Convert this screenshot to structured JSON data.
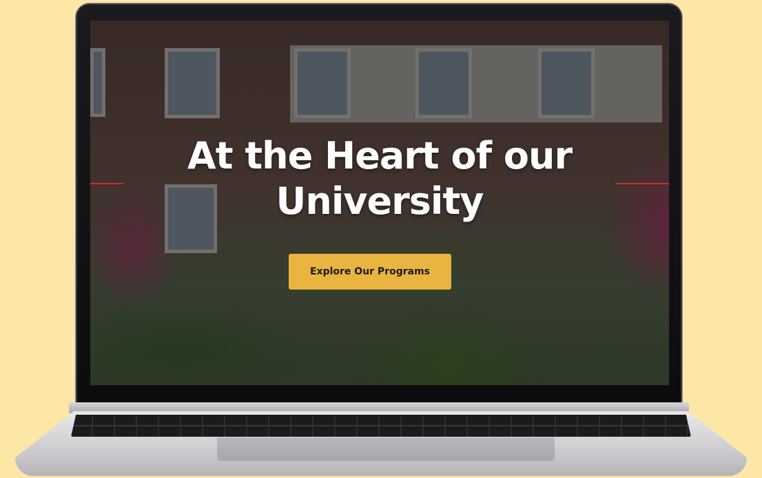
{
  "hero": {
    "title_line1": "At the Heart of our",
    "title_line2": "University",
    "cta_label": "Explore Our Programs"
  },
  "colors": {
    "background": "#fde7a6",
    "cta": "#e9b43f",
    "accent_line": "#c93030",
    "title": "#ffffff"
  }
}
